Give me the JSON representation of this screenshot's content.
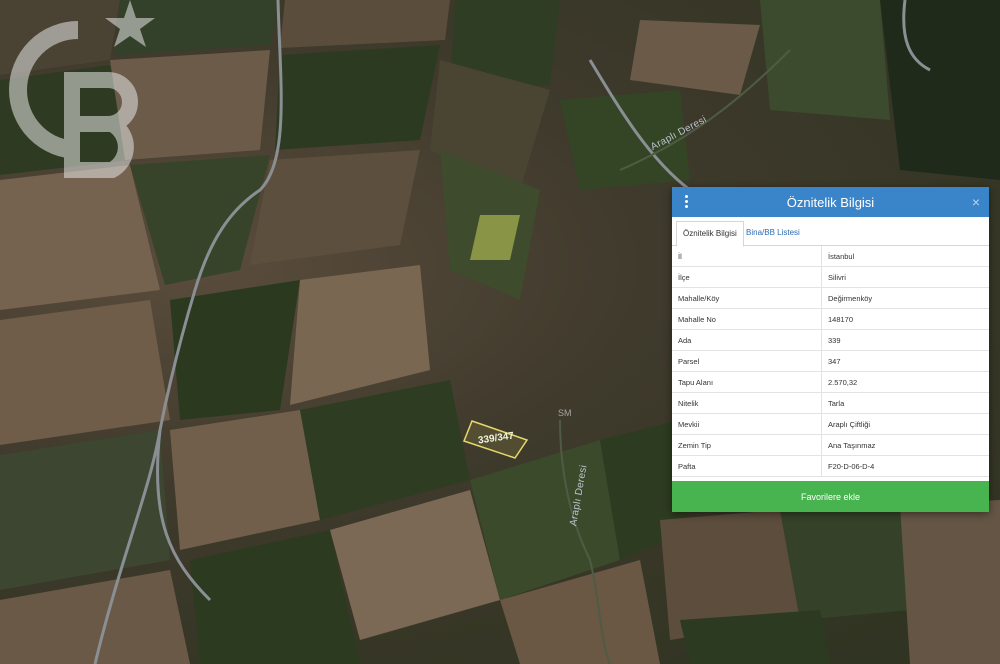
{
  "map": {
    "river_labels": [
      "Araplı Deresi",
      "Araplı Deresi"
    ],
    "parcel_label": "339/347",
    "watermark_mark": "SM"
  },
  "panel": {
    "title": "Öznitelik Bilgisi",
    "menu_icon": "vertical-dots-icon",
    "close_icon": "close-icon",
    "close_symbol": "×",
    "tabs": [
      {
        "label": "Öznitelik Bilgisi",
        "active": true
      },
      {
        "label": "Bina/BB Listesi",
        "active": false
      }
    ],
    "rows": [
      {
        "key": "İl",
        "value": "İstanbul"
      },
      {
        "key": "İlçe",
        "value": "Silivri"
      },
      {
        "key": "Mahalle/Köy",
        "value": "Değirmenköy"
      },
      {
        "key": "Mahalle No",
        "value": "148170"
      },
      {
        "key": "Ada",
        "value": "339"
      },
      {
        "key": "Parsel",
        "value": "347"
      },
      {
        "key": "Tapu Alanı",
        "value": "2.570,32"
      },
      {
        "key": "Nitelik",
        "value": "Tarla"
      },
      {
        "key": "Mevkii",
        "value": "Araplı Çiftliği"
      },
      {
        "key": "Zemin Tip",
        "value": "Ana Taşınmaz"
      },
      {
        "key": "Pafta",
        "value": "F20-D-06-D-4"
      }
    ],
    "favorite_button": "Favorilere ekle",
    "colors": {
      "header": "#3a84c9",
      "button": "#47b44f",
      "tab_link": "#2a6cb7"
    }
  }
}
